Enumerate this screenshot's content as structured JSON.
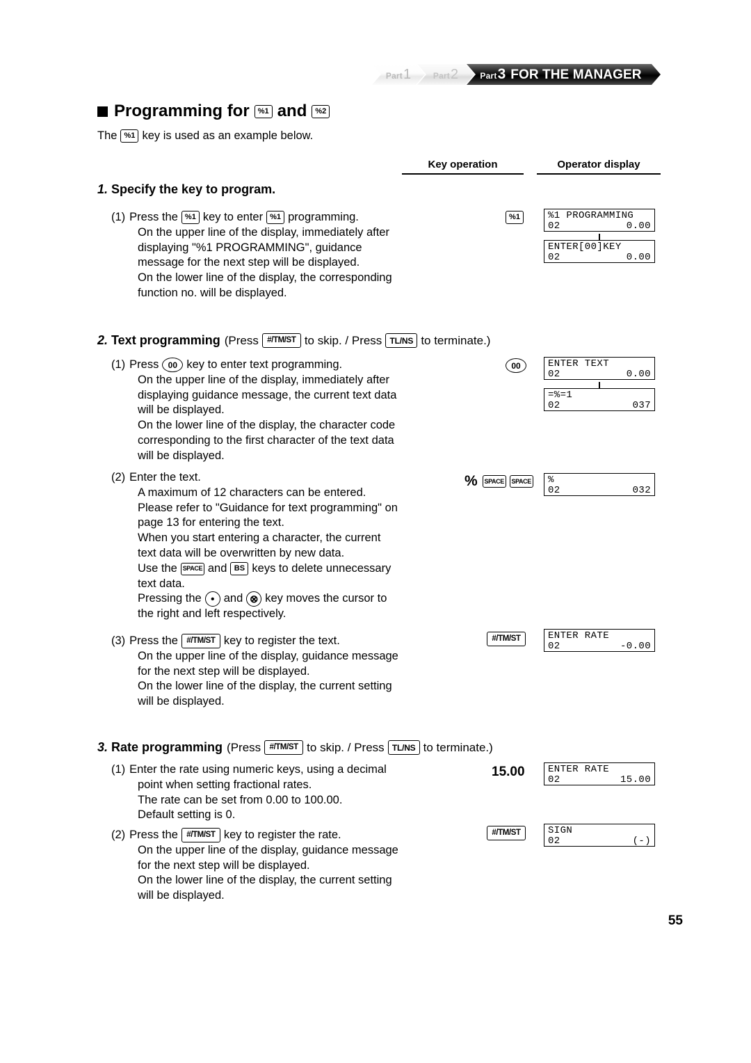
{
  "header": {
    "parts": [
      {
        "word": "Part",
        "num": "1"
      },
      {
        "word": "Part",
        "num": "2"
      },
      {
        "word": "Part",
        "num": "3"
      }
    ],
    "title": "FOR THE MANAGER"
  },
  "section": {
    "title_pre": "Programming for",
    "title_key1": "%1",
    "title_mid": "and",
    "title_key2": "%2",
    "intro_pre": "The",
    "intro_key": "%1",
    "intro_post": "key is used as an example below."
  },
  "columns": {
    "key_operation": "Key operation",
    "operator_display": "Operator display"
  },
  "keys": {
    "pct1": "%1",
    "pct2": "%2",
    "tmst": "#/TM/ST",
    "tlns": "TL/NS",
    "zerozero": "00",
    "space": "SPACE",
    "bs": "BS",
    "dot": "•",
    "multiply": "⊗",
    "percent_symbol": "%"
  },
  "steps": [
    {
      "num": "1.",
      "title": "Specify the key to program.",
      "items": [
        {
          "label": "(1)",
          "lines": [
            {
              "parts": [
                "Press the",
                "KEY:pct1",
                "key to enter",
                "KEY:pct1",
                "programming."
              ]
            },
            {
              "text": "On the upper line of the display, immediately after"
            },
            {
              "text": "displaying \"%1 PROGRAMMING\", guidance"
            },
            {
              "text": "message for the next step will be displayed."
            },
            {
              "text": "On the lower line of the display, the corresponding"
            },
            {
              "text": "function no. will be displayed."
            }
          ]
        }
      ]
    },
    {
      "num": "2.",
      "title": "Text programming",
      "title_suffix_1": "(Press",
      "title_suffix_2": "to skip. / Press",
      "title_suffix_3": "to terminate.)",
      "items": [
        {
          "label": "(1)",
          "lines": [
            {
              "parts": [
                "Press",
                "CIRC:zerozero",
                "key to enter text programming."
              ]
            },
            {
              "text": "On the upper line of the display, immediately after"
            },
            {
              "text": "displaying guidance message, the current text data"
            },
            {
              "text": "will be displayed."
            },
            {
              "text": "On the lower line of the display, the character code"
            },
            {
              "text": "corresponding to the first character of the text data"
            },
            {
              "text": "will be displayed."
            }
          ]
        },
        {
          "label": "(2)",
          "lines": [
            {
              "text": "Enter the text."
            },
            {
              "text": "A maximum of 12 characters can be entered."
            },
            {
              "text": "Please refer to \"Guidance for text programming\" on"
            },
            {
              "text": "page 13 for entering the text."
            },
            {
              "text": "When you start entering a character, the current"
            },
            {
              "text": "text data will be overwritten by new data."
            },
            {
              "parts": [
                "Use the",
                "KEY:space",
                "and",
                "KEY:bs",
                "keys to delete unnecessary"
              ]
            },
            {
              "text": "text data."
            },
            {
              "parts": [
                "Pressing the",
                "CIRC:dot",
                "and",
                "CIRC:multiply",
                "key moves the cursor to"
              ]
            },
            {
              "text": "the right and left respectively."
            }
          ]
        },
        {
          "label": "(3)",
          "lines": [
            {
              "parts": [
                "Press the",
                "KEY:tmst",
                "key to register the text."
              ]
            },
            {
              "text": "On the upper line of the display, guidance message"
            },
            {
              "text": "for the next step will be displayed."
            },
            {
              "text": "On the lower line of the display, the current setting"
            },
            {
              "text": "will be displayed."
            }
          ]
        }
      ]
    },
    {
      "num": "3.",
      "title": "Rate programming",
      "title_suffix_1": "(Press",
      "title_suffix_2": "to skip. / Press",
      "title_suffix_3": "to terminate.)",
      "items": [
        {
          "label": "(1)",
          "lines": [
            {
              "text": "Enter the rate using numeric keys, using a decimal"
            },
            {
              "text": "point when setting fractional rates."
            },
            {
              "text": "The rate can be set from 0.00 to 100.00."
            },
            {
              "text": "Default setting is 0."
            }
          ]
        },
        {
          "label": "(2)",
          "lines": [
            {
              "parts": [
                "Press the",
                "KEY:tmst",
                "key to register the rate."
              ]
            },
            {
              "text": "On the upper line of the display, guidance message"
            },
            {
              "text": "for the next step will be displayed."
            },
            {
              "text": "On the lower line of the display, the current setting"
            },
            {
              "text": "will be displayed."
            }
          ]
        }
      ]
    }
  ],
  "operations": {
    "op1_key": "%1",
    "op2_key": "00",
    "op3_symbol": "%",
    "op3_space1": "SPACE",
    "op3_space2": "SPACE",
    "op4_key": "#/TM/ST",
    "op5_value": "15.00",
    "op6_key": "#/TM/ST"
  },
  "displays": {
    "d1": {
      "top_left": "%1 PROGRAMMING",
      "top_right": "",
      "bot_left": "02",
      "bot_right": "0.00"
    },
    "d2": {
      "top_left": "ENTER[00]KEY",
      "top_right": "",
      "bot_left": "02",
      "bot_right": "0.00"
    },
    "d3": {
      "top_left": "ENTER TEXT",
      "top_right": "",
      "bot_left": "02",
      "bot_right": "0.00"
    },
    "d4": {
      "top_left": "=%=1",
      "top_right": "",
      "bot_left": "02",
      "bot_right": "037"
    },
    "d5": {
      "top_left": "%",
      "top_right": "",
      "bot_left": "02",
      "bot_right": "032"
    },
    "d6": {
      "top_left": "ENTER RATE",
      "top_right": "",
      "bot_left": "02",
      "bot_right": "-0.00"
    },
    "d7": {
      "top_left": "ENTER RATE",
      "top_right": "",
      "bot_left": "02",
      "bot_right": "15.00"
    },
    "d8": {
      "top_left": "SIGN",
      "top_right": "",
      "bot_left": "02",
      "bot_right": "(-)"
    }
  },
  "page_number": "55"
}
